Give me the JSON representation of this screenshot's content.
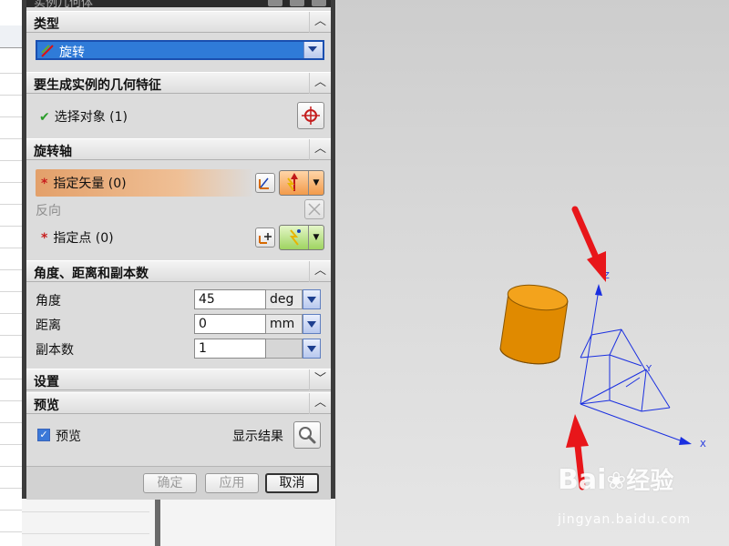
{
  "dialog": {
    "title": "实例几何体",
    "sections": {
      "type": {
        "label": "类型",
        "selected": "旋转"
      },
      "geometry": {
        "label": "要生成实例的几何特征",
        "select_object": "选择对象 (1)"
      },
      "axis": {
        "label": "旋转轴",
        "specify_vector": "指定矢量 (0)",
        "reverse": "反向",
        "specify_point": "指定点 (0)"
      },
      "angle": {
        "label": "角度、距离和副本数",
        "rows": [
          {
            "label": "角度",
            "value": "45",
            "unit": "deg"
          },
          {
            "label": "距离",
            "value": "0",
            "unit": "mm"
          },
          {
            "label": "副本数",
            "value": "1",
            "unit": ""
          }
        ]
      },
      "settings": {
        "label": "设置"
      },
      "preview": {
        "label": "预览",
        "checkbox_label": "预览",
        "checked": true,
        "show_result": "显示结果"
      }
    },
    "buttons": {
      "ok": "确定",
      "apply": "应用",
      "cancel": "取消"
    }
  },
  "viewport": {
    "axis_labels": {
      "x": "X",
      "y": "Y",
      "z": "Z"
    },
    "cylinder_color": "#e08a00",
    "arrow_color": "#e8161a",
    "axis_color": "#1a2fe0"
  },
  "watermark": {
    "brand": "Bai",
    "brand_cn": "经验",
    "url": "jingyan.baidu.com"
  }
}
